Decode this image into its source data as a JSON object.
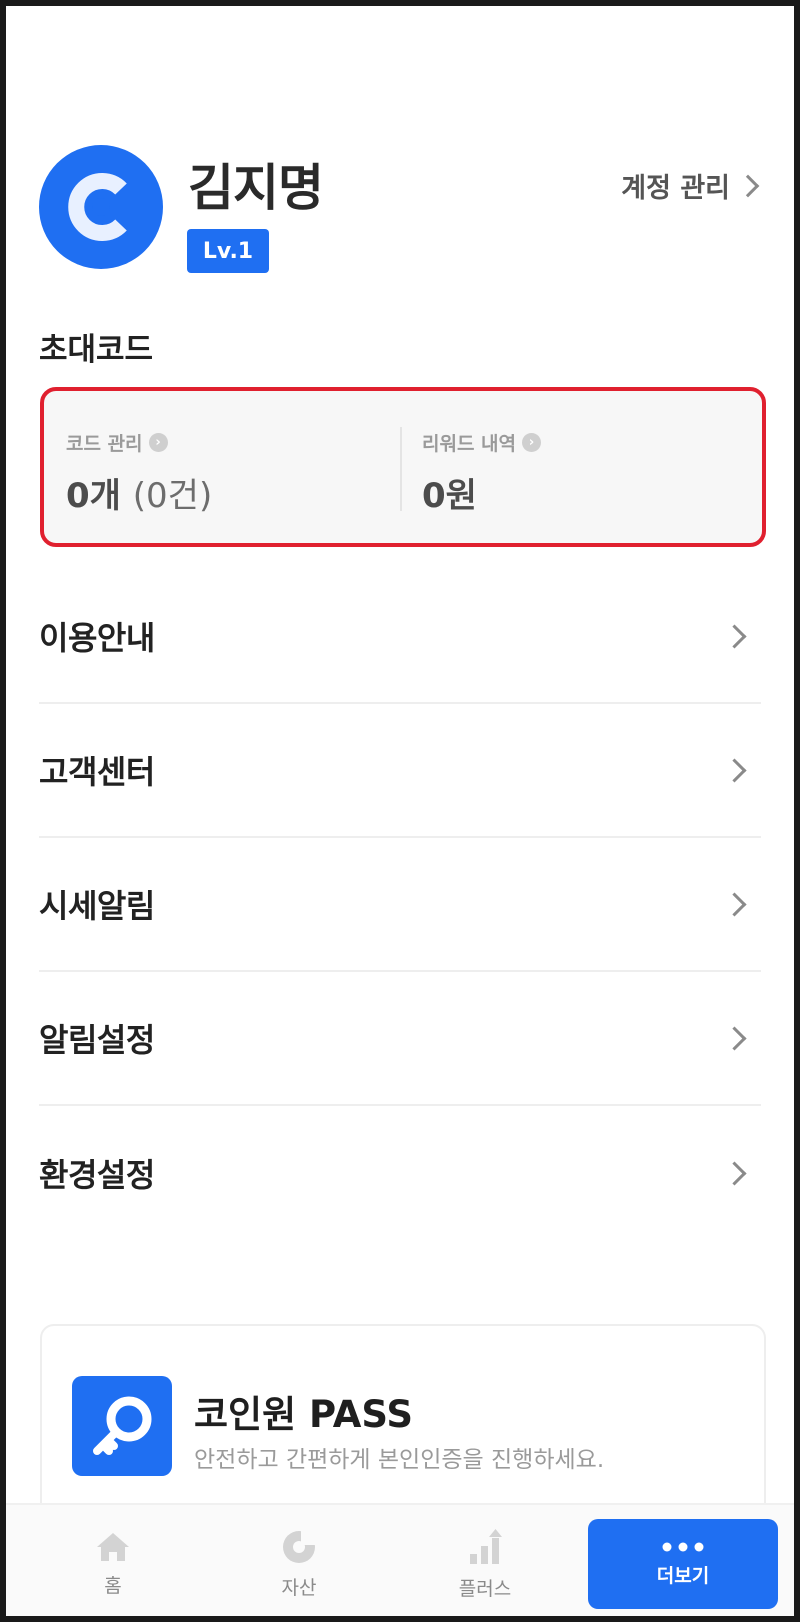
{
  "profile": {
    "name": "김지명",
    "level": "Lv.1",
    "account_link": "계정 관리"
  },
  "invite": {
    "title": "초대코드",
    "code_label": "코드 관리",
    "code_value": "0개",
    "code_sub": "(0건)",
    "reward_label": "리워드 내역",
    "reward_value": "0원"
  },
  "menu": [
    {
      "label": "이용안내"
    },
    {
      "label": "고객센터"
    },
    {
      "label": "시세알림"
    },
    {
      "label": "알림설정"
    },
    {
      "label": "환경설정"
    }
  ],
  "pass_card": {
    "title": "코인원 PASS",
    "desc": "안전하고 간편하게 본인인증을 진행하세요."
  },
  "nav": [
    {
      "label": "홈",
      "icon": "home-icon"
    },
    {
      "label": "자산",
      "icon": "pie-chart-icon"
    },
    {
      "label": "플러스",
      "icon": "bar-chart-up-icon"
    },
    {
      "label": "더보기",
      "icon": "more-dots-icon",
      "active": true
    }
  ],
  "colors": {
    "brand": "#1f6ff2",
    "highlight_border": "#e0202f"
  }
}
